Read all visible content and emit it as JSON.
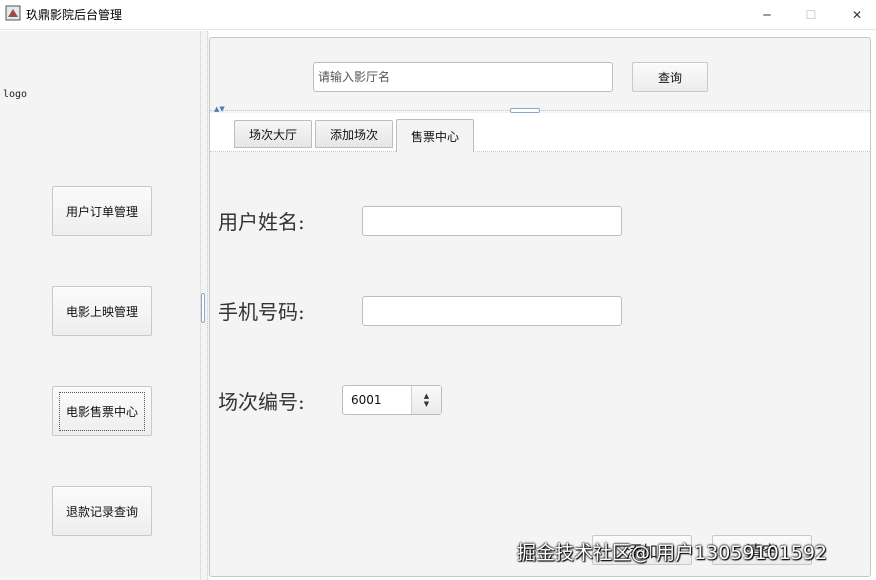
{
  "window": {
    "title": "玖鼎影院后台管理",
    "minimize": "─",
    "maximize": "☐",
    "close": "✕"
  },
  "sidebar": {
    "logo": "logo",
    "items": [
      {
        "label": "用户订单管理"
      },
      {
        "label": "电影上映管理"
      },
      {
        "label": "电影售票中心"
      },
      {
        "label": "退款记录查询"
      }
    ]
  },
  "search": {
    "placeholder": "请输入影厅名",
    "button_label": "查询"
  },
  "tabs": [
    {
      "label": "场次大厅"
    },
    {
      "label": "添加场次"
    },
    {
      "label": "售票中心"
    }
  ],
  "form": {
    "name_label": "用户姓名:",
    "phone_label": "手机号码:",
    "session_label": "场次编号:",
    "session_value": "6001"
  },
  "actions": {
    "add_label": "添加",
    "clear_label": "清空"
  },
  "watermark": "掘金技术社区@ 用户13059101592"
}
